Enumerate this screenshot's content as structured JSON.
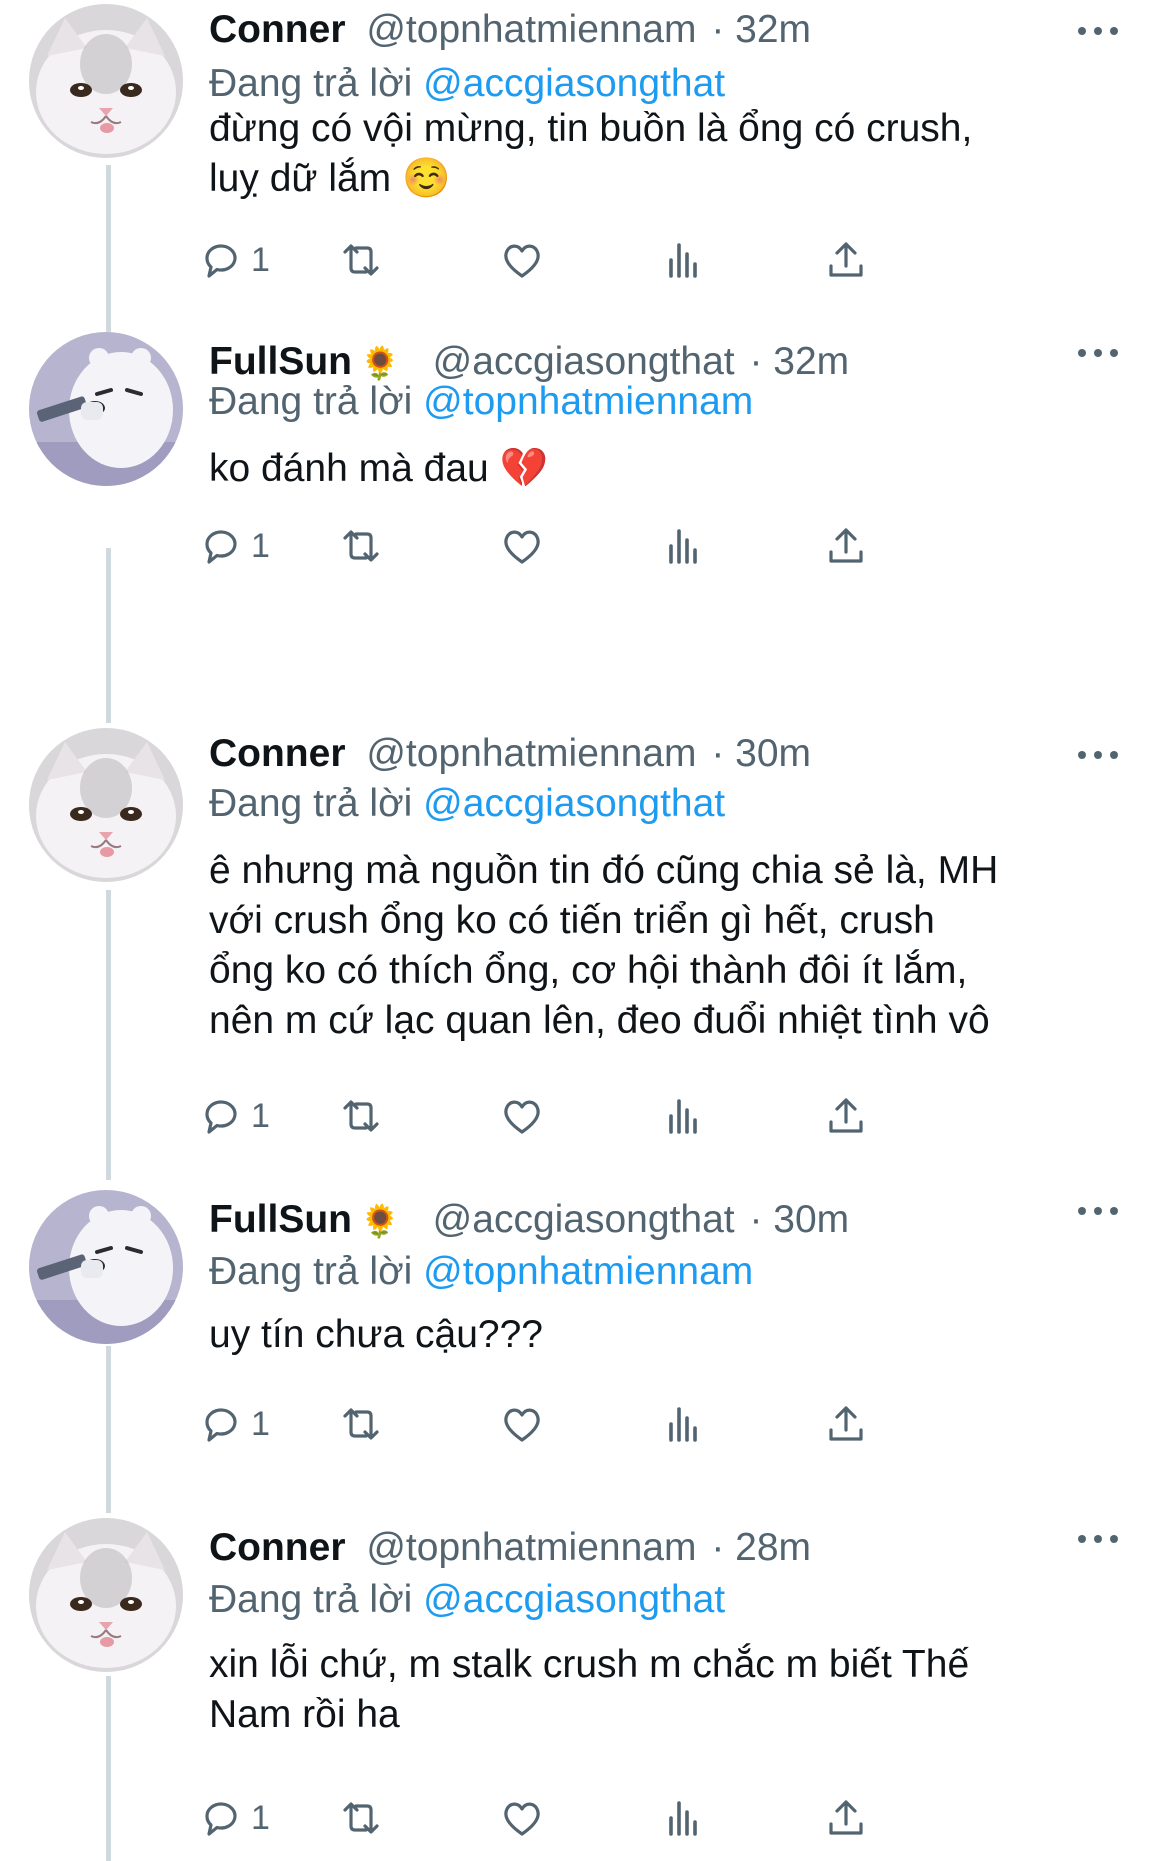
{
  "tweets": [
    {
      "name": "Conner",
      "handle": "@topnhatmiennam",
      "time": "· 32m",
      "reply_prefix": "Đang trả lời",
      "reply_to": "@accgiasongthat",
      "text": "đừng có vội mừng, tin buồn là ổng có crush,\nluỵ dữ lắm ☺️",
      "reply_count": "1",
      "avatar": "cat-avatar"
    },
    {
      "name": "FullSun",
      "name_emoji": "🌻",
      "handle": "@accgiasongthat",
      "time": "· 32m",
      "reply_prefix": "Đang trả lời",
      "reply_to": "@topnhatmiennam",
      "text": "ko đánh mà đau 💔",
      "reply_count": "1",
      "avatar": "bear-avatar"
    },
    {
      "name": "Conner",
      "handle": "@topnhatmiennam",
      "time": "· 30m",
      "reply_prefix": "Đang trả lời",
      "reply_to": "@accgiasongthat",
      "text": "ê nhưng mà nguồn tin đó cũng chia sẻ là, MH\nvới crush ổng ko có tiến triển gì hết, crush\nổng ko có thích ổng, cơ hội thành đôi ít lắm,\nnên m cứ lạc quan lên, đeo đuổi nhiệt tình vô",
      "reply_count": "1",
      "avatar": "cat-avatar"
    },
    {
      "name": "FullSun",
      "name_emoji": "🌻",
      "handle": "@accgiasongthat",
      "time": "· 30m",
      "reply_prefix": "Đang trả lời",
      "reply_to": "@topnhatmiennam",
      "text": "uy tín chưa cậu???",
      "reply_count": "1",
      "avatar": "bear-avatar"
    },
    {
      "name": "Conner",
      "handle": "@topnhatmiennam",
      "time": "· 28m",
      "reply_prefix": "Đang trả lời",
      "reply_to": "@accgiasongthat",
      "text": "xin lỗi chứ, m stalk crush m chắc m biết Thế\nNam rồi ha",
      "reply_count": "1",
      "avatar": "cat-avatar"
    }
  ],
  "icons": {
    "reply": "reply-icon",
    "retweet": "retweet-icon",
    "like": "heart-icon",
    "views": "views-icon",
    "share": "share-icon",
    "more": "more-icon"
  },
  "colors": {
    "text": "#0f1419",
    "secondary": "#536471",
    "link": "#1d9bf0",
    "thread_line": "#cfd9de"
  }
}
